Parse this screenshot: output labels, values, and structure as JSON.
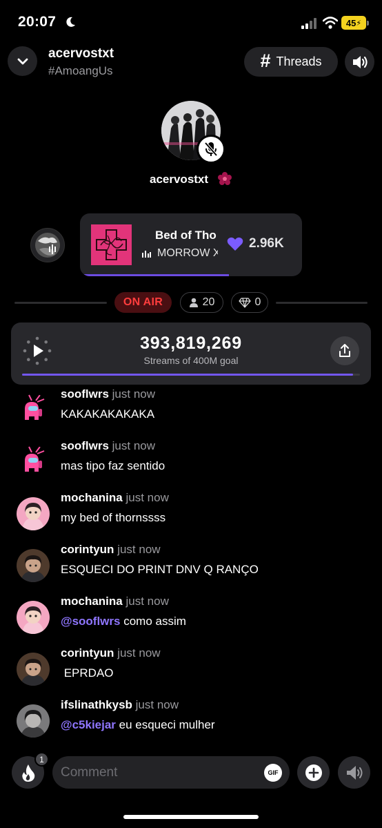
{
  "status_bar": {
    "time": "20:07",
    "battery": "45"
  },
  "header": {
    "title": "acervostxt",
    "subtitle": "#AmoangUs",
    "threads_label": "Threads"
  },
  "host": {
    "name": "acervostxt",
    "muted": true
  },
  "music": {
    "song_title": "Bed of Tho",
    "artist": "MORROW X",
    "likes": "2.96K",
    "progress": 0.67,
    "accent": "#7357f0"
  },
  "room": {
    "on_air": "ON AIR",
    "listeners": "20",
    "gems": "0"
  },
  "goal": {
    "count": "393,819,269",
    "label": "Streams of 400M goal",
    "progress": 0.98
  },
  "chat": [
    {
      "user": "sooflwrs",
      "time": "just now",
      "text": "KAKAKAKAKAKA",
      "avatar": "amongus"
    },
    {
      "user": "sooflwrs",
      "time": "just now",
      "text": "mas tipo faz sentido",
      "avatar": "amongus"
    },
    {
      "user": "mochanina",
      "time": "just now",
      "text": "my bed of thornssss",
      "avatar": "pink"
    },
    {
      "user": "corintyun",
      "time": "just now",
      "text": "ESQUECI DO PRINT DNV Q RANÇO",
      "avatar": "dark"
    },
    {
      "user": "mochanina",
      "time": "just now",
      "mention": "@sooflwrs",
      "text": " como assim",
      "avatar": "pink"
    },
    {
      "user": "corintyun",
      "time": "just now",
      "text": " EPRDAO",
      "avatar": "dark"
    },
    {
      "user": "ifslinathkysb",
      "time": "just now",
      "mention": "@c5kiejar",
      "text": " eu esqueci mulher",
      "avatar": "gray"
    }
  ],
  "bottom_bar": {
    "fire_count": "1",
    "comment_placeholder": "Comment",
    "gif_label": "GIF"
  }
}
